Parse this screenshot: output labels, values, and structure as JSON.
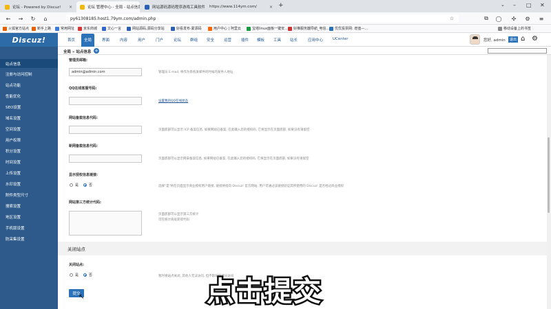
{
  "browser": {
    "tabs": [
      {
        "title": "论坛 - Powered by Discuz!",
        "active": false
      },
      {
        "title": "论坛 管理中心 - 全局 - 站点信息",
        "active": true
      },
      {
        "title": "网站源码源码程序游戏工具软件",
        "active": false
      },
      {
        "title": "https://www.114ym.com/",
        "active": false
      }
    ],
    "new_tab": "+",
    "url": "py61308185.host1.79ym.com/admin.php",
    "bookmarks": [
      "火狐官方站点",
      "新手上路",
      "常用网址",
      "京东商城",
      "文心一言",
      "网站源码,源码分享站",
      "好看发布·蒙源码",
      "用户中心 | 阿里云",
      "宝塔linux面板一键安...",
      "好推服务器导航_电信...",
      "优优投票网: 增值—...",
      "移动设备上的书签"
    ]
  },
  "header": {
    "logo": "Discuz!",
    "menu": [
      "首页",
      "全局",
      "界面",
      "内容",
      "用户",
      "门户",
      "论坛",
      "群组",
      "安全",
      "运营",
      "插件",
      "模板",
      "工具",
      "站长",
      "应用中心",
      "UCenter"
    ],
    "active_menu": "全局",
    "greeting": "您好, admin",
    "logout": "退出",
    "home_icon": "home-icon",
    "settings_icon": "gear-icon"
  },
  "breadcrumb": "全局 » 站点信息",
  "sidebar": {
    "items": [
      "站点信息",
      "注册与访问控制",
      "站点功能",
      "性能优化",
      "SEO设置",
      "域名设置",
      "空间设置",
      "用户权限",
      "积分设置",
      "时间设置",
      "上传设置",
      "水印设置",
      "附件类型尺寸",
      "搜索设置",
      "地区设置",
      "手机版设置",
      "防采集设置"
    ],
    "active": "站点信息"
  },
  "form": {
    "admin_email": {
      "label": "管理员邮箱:",
      "value": "admin@admin.com",
      "hint": "管理员 E-mail, 将作为系统发邮件的时候的发件人地址"
    },
    "qq": {
      "label": "QQ在线客服号码:",
      "value": "",
      "link": "设置我的QQ在线状态"
    },
    "icp": {
      "label": "网站备案信息代码:",
      "value": "",
      "hint": "页面底部可以显示 ICP 备案信息, 如果网站已备案, 在此输入您的授权码, 它将显示在页面底部, 如果没有请留空"
    },
    "police": {
      "label": "新网备案信息代码:",
      "value": "",
      "hint": "页面底部可以显示网安备案信息, 如果网站已备案, 在此输入您的授权码, 它将显示在页面底部, 如果没有请留空"
    },
    "license": {
      "label": "显示授权信息链接:",
      "options": [
        "是",
        "否"
      ],
      "selected": "否",
      "hint": "选择\"是\"将在页面显示商业授权用户链接, 链接将指向 Discuz! 官方网站, 用户可通过该链接验证其所使用的 Discuz! 是否经过商业授权"
    },
    "stats": {
      "label": "网站第三方统计代码:",
      "value": "",
      "hint1": "页面底部可以显示第三方统计",
      "hint2": "可在统计商处获得代码"
    },
    "close_section": "关闭站点",
    "close": {
      "label": "关闭站点:",
      "options": [
        "是",
        "否"
      ],
      "selected": "否",
      "hint": "暂时将站点关闭, 其他人无法访问, 但不影响管理员访问"
    },
    "submit": "提交"
  },
  "overlay_caption": "点击提交"
}
